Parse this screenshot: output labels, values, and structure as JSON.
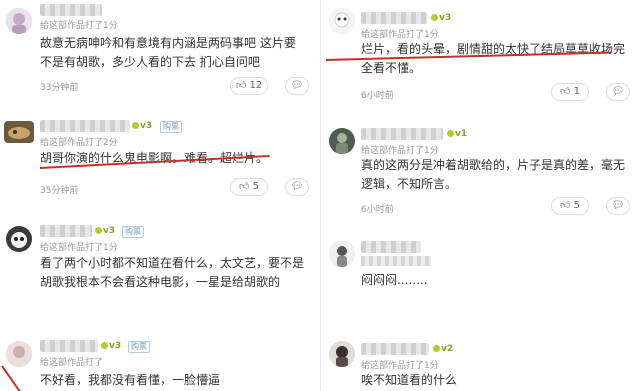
{
  "meta_label": "给这部作品打了",
  "tag_label": "购票",
  "left": [
    {
      "score": "1分",
      "lines": [
        "故意无病呻吟和有意境有内涵是两码事吧 这片要",
        "不是有胡歌，多少人看的下去 扪心自问吧"
      ],
      "time": "33分钟前",
      "likes": "12"
    },
    {
      "level": "v3",
      "score": "2分",
      "lines": [
        "胡哥你演的什么鬼电影啊。难看。超烂片。"
      ],
      "time": "35分钟前",
      "likes": "5"
    },
    {
      "level": "v3",
      "score": "1分",
      "lines": [
        "看了两个小时都不知道在看什么，太文艺，要不是",
        "胡歌我根本不会看这种电影，一星是给胡歌的"
      ],
      "time": "",
      "likes": ""
    },
    {
      "level": "v3",
      "score": "",
      "lines": [
        "不好看，我都没有看懂，一脸懵逼"
      ]
    }
  ],
  "right": [
    {
      "level": "v3",
      "score": "1分",
      "lines": [
        "烂片，看的头晕，剧情甜的太快了结局草草收场完",
        "全看不懂。"
      ],
      "time": "6小时前",
      "likes": "1"
    },
    {
      "level": "v1",
      "score": "1分",
      "lines": [
        "真的这两分是冲着胡歌给的，片子是真的差，毫无",
        "逻辑，不知所言。"
      ],
      "time": "6小时前",
      "likes": "5"
    },
    {
      "level": "",
      "score": "",
      "lines": [
        "闷闷闷........"
      ]
    },
    {
      "level": "v2",
      "score": "1分",
      "lines": [
        "唉不知道看的什么"
      ]
    }
  ]
}
